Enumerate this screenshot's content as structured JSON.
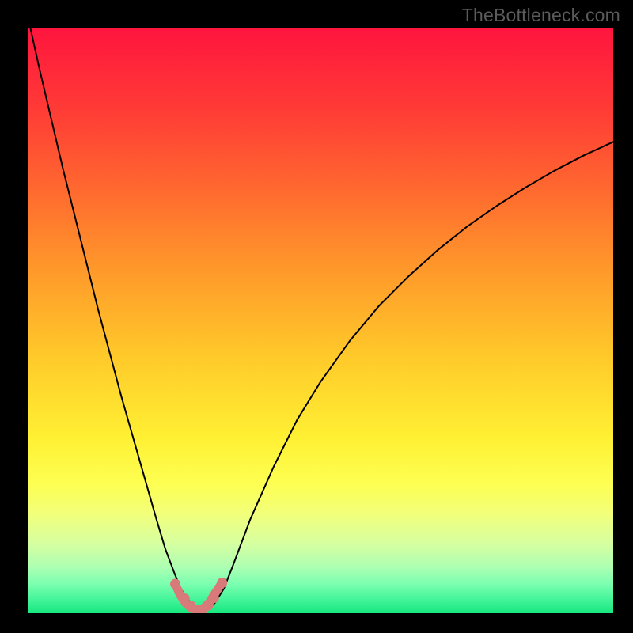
{
  "watermark": "TheBottleneck.com",
  "chart_data": {
    "type": "line",
    "title": "",
    "xlabel": "",
    "ylabel": "",
    "xlim": [
      0,
      100
    ],
    "ylim": [
      0,
      100
    ],
    "background_gradient": {
      "stops": [
        {
          "offset": 0.0,
          "color": "#ff153e"
        },
        {
          "offset": 0.14,
          "color": "#ff3b36"
        },
        {
          "offset": 0.28,
          "color": "#ff6a2f"
        },
        {
          "offset": 0.42,
          "color": "#ff9b2a"
        },
        {
          "offset": 0.56,
          "color": "#ffc92a"
        },
        {
          "offset": 0.7,
          "color": "#fff033"
        },
        {
          "offset": 0.78,
          "color": "#fdff52"
        },
        {
          "offset": 0.83,
          "color": "#f2ff7a"
        },
        {
          "offset": 0.88,
          "color": "#d7ffa0"
        },
        {
          "offset": 0.92,
          "color": "#aeffb2"
        },
        {
          "offset": 0.95,
          "color": "#7bffb0"
        },
        {
          "offset": 0.975,
          "color": "#47f59a"
        },
        {
          "offset": 1.0,
          "color": "#16e87f"
        }
      ]
    },
    "series": [
      {
        "name": "bottleneck-curve",
        "stroke": "#000000",
        "stroke_width": 2.0,
        "x": [
          0,
          2,
          4,
          6,
          8,
          10,
          12,
          14,
          16,
          18,
          20,
          22,
          23.5,
          25,
          26,
          27,
          28,
          29,
          30,
          31,
          32,
          33.5,
          35,
          38,
          42,
          46,
          50,
          55,
          60,
          65,
          70,
          75,
          80,
          85,
          90,
          95,
          100
        ],
        "y": [
          102,
          93,
          84.5,
          76,
          68,
          60,
          52,
          44.5,
          37,
          30,
          23,
          16,
          11,
          7,
          4.5,
          2.8,
          1.6,
          0.8,
          0.4,
          0.8,
          1.8,
          4.2,
          8,
          16,
          25,
          33,
          39.5,
          46.5,
          52.5,
          57.5,
          62,
          66,
          69.5,
          72.7,
          75.6,
          78.2,
          80.5
        ]
      },
      {
        "name": "marker-dots",
        "type": "scatter",
        "fill": "#d97a7a",
        "radius": 6.5,
        "x": [
          25.2,
          26.8,
          27.8,
          28.8,
          29.8,
          30.8,
          31.8,
          33.2
        ],
        "y": [
          5,
          2.5,
          1.3,
          0.6,
          0.6,
          1.3,
          2.6,
          5.2
        ]
      },
      {
        "name": "marker-arc",
        "stroke": "#d97a7a",
        "stroke_width": 11,
        "x": [
          25.2,
          26.0,
          27.0,
          28.0,
          29.0,
          30.0,
          31.0,
          32.0,
          33.2
        ],
        "y": [
          5,
          3.2,
          1.7,
          0.8,
          0.45,
          0.8,
          1.8,
          3.4,
          5.2
        ]
      }
    ]
  }
}
